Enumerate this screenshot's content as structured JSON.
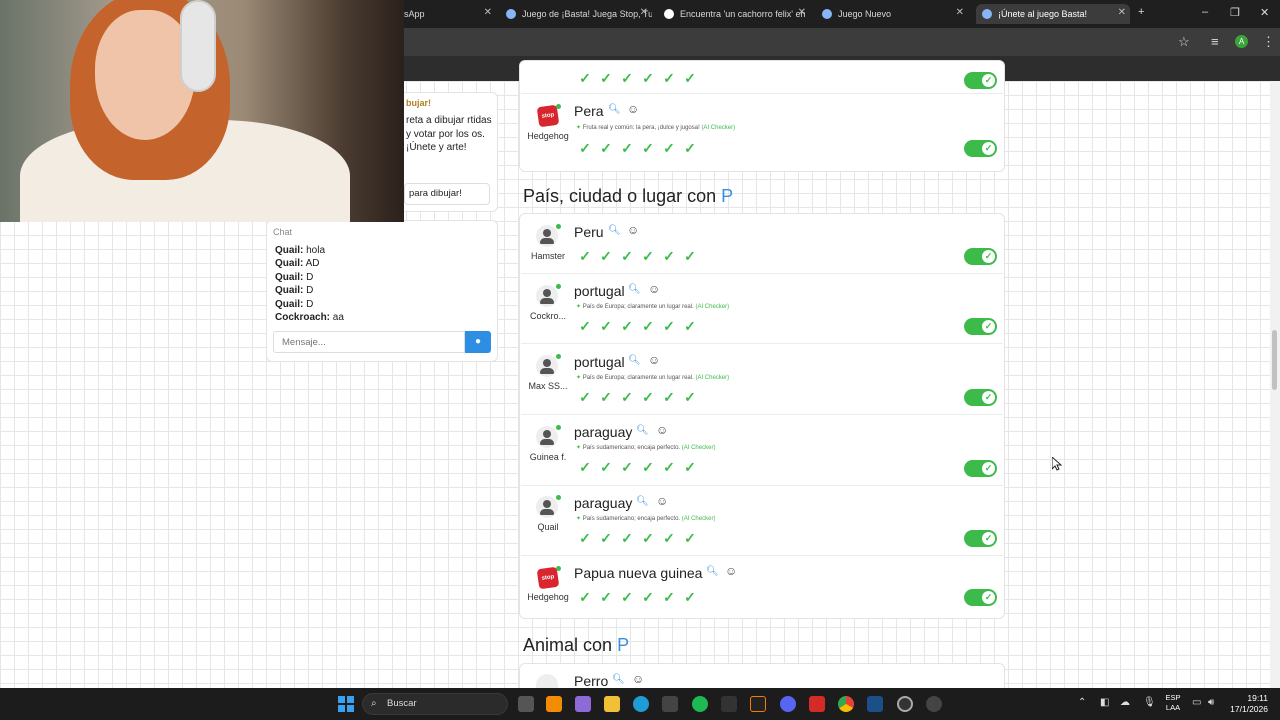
{
  "browser": {
    "tabs": [
      {
        "label": "sApp",
        "icon": "whatsapp-icon"
      },
      {
        "label": "Juego de ¡Basta! Juega Stop, Tu",
        "icon": "globe-icon"
      },
      {
        "label": "Encuentra 'un cachorro felix' en",
        "icon": "tiktok-icon"
      },
      {
        "label": "Juego Nuevo",
        "icon": "globe-icon"
      },
      {
        "label": "¡Únete al juego Basta!",
        "icon": "globe-icon"
      }
    ],
    "new_tab": "+",
    "profile_initial": "A"
  },
  "info_card": {
    "title": "bujar!",
    "text": "reta a dibujar rtidas y votar por los os. ¡Únete y arte!",
    "button": "para dibujar!"
  },
  "chat": {
    "title": "Chat",
    "messages": [
      {
        "user": "Quail:",
        "text": "hola"
      },
      {
        "user": "Quail:",
        "text": "AD"
      },
      {
        "user": "Quail:",
        "text": "D"
      },
      {
        "user": "Quail:",
        "text": "D"
      },
      {
        "user": "Quail:",
        "text": "D"
      },
      {
        "user": "Cockroach:",
        "text": "aa"
      }
    ],
    "input_placeholder": "Mensaje..."
  },
  "fruit_section": {
    "answer": "Pera",
    "player": "Hedgehog",
    "note": "Fruta real y común: la pera, ¡dulce y jugosa!",
    "ai_label": "(AI Checker)"
  },
  "country_section": {
    "title_prefix": "País, ciudad o lugar con",
    "letter": "P",
    "rows": [
      {
        "answer": "Peru",
        "player": "Hamster",
        "note": "",
        "ai_label": ""
      },
      {
        "answer": "portugal",
        "player": "Cockro...",
        "note": "País de Europa; claramente un lugar real.",
        "ai_label": "(AI Checker)"
      },
      {
        "answer": "portugal",
        "player": "Max SS...",
        "note": "País de Europa; claramente un lugar real.",
        "ai_label": "(AI Checker)"
      },
      {
        "answer": "paraguay",
        "player": "Guinea f.",
        "note": "País sudamericano; encaja perfecto.",
        "ai_label": "(AI Checker)"
      },
      {
        "answer": "paraguay",
        "player": "Quail",
        "note": "País sudamericano; encaja perfecto.",
        "ai_label": "(AI Checker)"
      },
      {
        "answer": "Papua nueva guinea",
        "player": "Hedgehog",
        "note": "",
        "ai_label": ""
      }
    ]
  },
  "animal_section": {
    "title_prefix": "Animal con",
    "letter": "P",
    "first_answer": "Perro"
  },
  "stop_logo_text": "stop",
  "check_count": 6,
  "taskbar": {
    "search": "Buscar",
    "lang_top": "ESP",
    "lang_bottom": "LAA",
    "time": "19:11",
    "date": "17/1/2026"
  },
  "colors": {
    "accent_blue": "#3a8fe0",
    "check_green": "#3dbb4a",
    "stop_red": "#d8252e"
  }
}
